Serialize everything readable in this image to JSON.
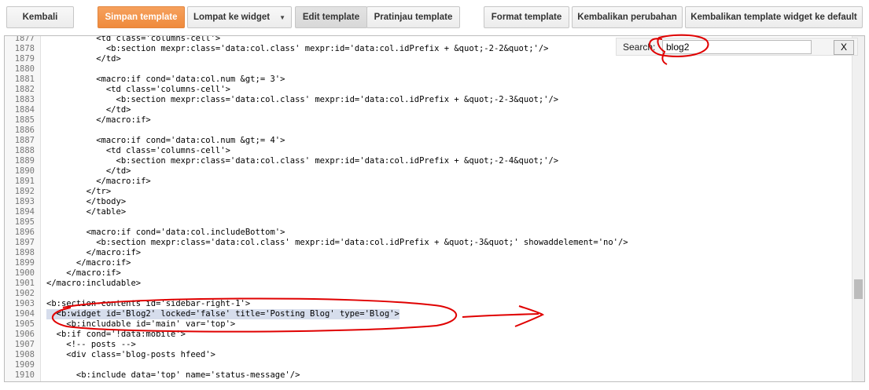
{
  "toolbar": {
    "back": "Kembali",
    "save": "Simpan template",
    "jump": "Lompat ke widget",
    "edit": "Edit template",
    "preview": "Pratinjau template",
    "format": "Format template",
    "revert": "Kembalikan perubahan",
    "revert_default": "Kembalikan template widget ke default"
  },
  "search": {
    "label": "Search:",
    "value": "blog2",
    "close": "X"
  },
  "colors": {
    "orange": "#f08a3c",
    "highlight": "#d6ddec",
    "annotation": "#e00000"
  },
  "annotation_icons": [
    "red-circle-annotation",
    "red-arrow-annotation"
  ],
  "code": {
    "highlight_line": "1904",
    "lines": [
      {
        "n": "1877",
        "t": "          <td class='columns-cell'>"
      },
      {
        "n": "1878",
        "t": "            <b:section mexpr:class='data:col.class' mexpr:id='data:col.idPrefix + &quot;-2-2&quot;'/>"
      },
      {
        "n": "1879",
        "t": "          </td>"
      },
      {
        "n": "1880",
        "t": ""
      },
      {
        "n": "1881",
        "t": "          <macro:if cond='data:col.num &gt;= 3'>"
      },
      {
        "n": "1882",
        "t": "            <td class='columns-cell'>"
      },
      {
        "n": "1883",
        "t": "              <b:section mexpr:class='data:col.class' mexpr:id='data:col.idPrefix + &quot;-2-3&quot;'/>"
      },
      {
        "n": "1884",
        "t": "            </td>"
      },
      {
        "n": "1885",
        "t": "          </macro:if>"
      },
      {
        "n": "1886",
        "t": ""
      },
      {
        "n": "1887",
        "t": "          <macro:if cond='data:col.num &gt;= 4'>"
      },
      {
        "n": "1888",
        "t": "            <td class='columns-cell'>"
      },
      {
        "n": "1889",
        "t": "              <b:section mexpr:class='data:col.class' mexpr:id='data:col.idPrefix + &quot;-2-4&quot;'/>"
      },
      {
        "n": "1890",
        "t": "            </td>"
      },
      {
        "n": "1891",
        "t": "          </macro:if>"
      },
      {
        "n": "1892",
        "t": "        </tr>"
      },
      {
        "n": "1893",
        "t": "        </tbody>"
      },
      {
        "n": "1894",
        "t": "        </table>"
      },
      {
        "n": "1895",
        "t": ""
      },
      {
        "n": "1896",
        "t": "        <macro:if cond='data:col.includeBottom'>"
      },
      {
        "n": "1897",
        "t": "          <b:section mexpr:class='data:col.class' mexpr:id='data:col.idPrefix + &quot;-3&quot;' showaddelement='no'/>"
      },
      {
        "n": "1898",
        "t": "        </macro:if>"
      },
      {
        "n": "1899",
        "t": "      </macro:if>"
      },
      {
        "n": "1900",
        "t": "    </macro:if>"
      },
      {
        "n": "1901",
        "t": "</macro:includable>"
      },
      {
        "n": "1902",
        "t": ""
      },
      {
        "n": "1903",
        "t": "<b:section-contents id='sidebar-right-1'>"
      },
      {
        "n": "1904",
        "t": "  <b:widget id='Blog2' locked='false' title='Posting Blog' type='Blog'>"
      },
      {
        "n": "1905",
        "t": "    <b:includable id='main' var='top'>"
      },
      {
        "n": "1906",
        "t": "  <b:if cond='!data:mobile'>"
      },
      {
        "n": "1907",
        "t": "    <!-- posts -->"
      },
      {
        "n": "1908",
        "t": "    <div class='blog-posts hfeed'>"
      },
      {
        "n": "1909",
        "t": ""
      },
      {
        "n": "1910",
        "t": "      <b:include data='top' name='status-message'/>"
      }
    ]
  }
}
